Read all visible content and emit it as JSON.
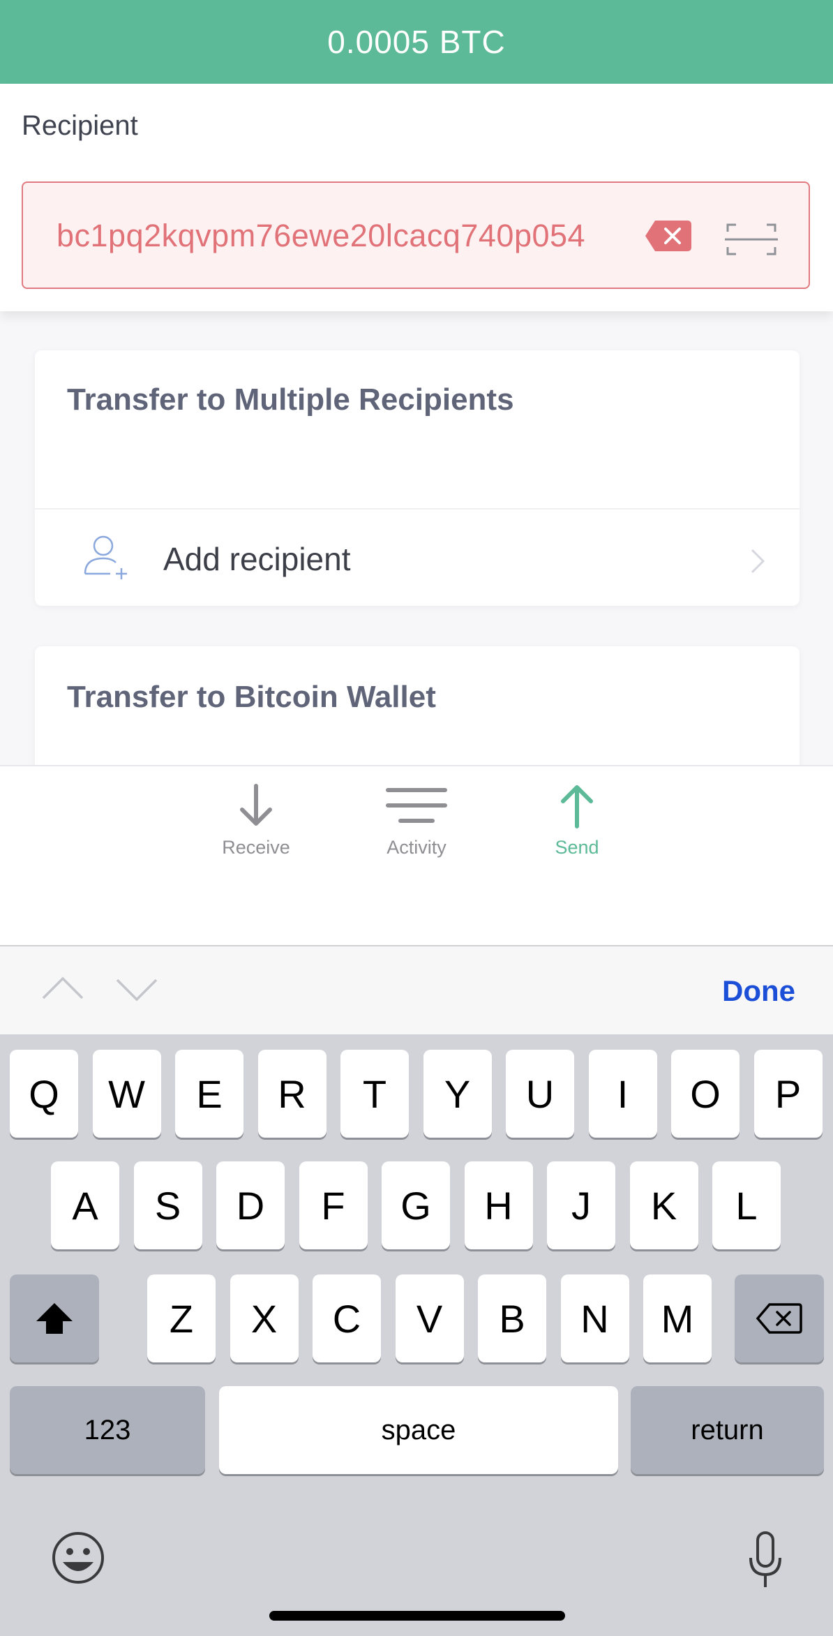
{
  "header": {
    "amount": "0.0005 BTC"
  },
  "recipient": {
    "label": "Recipient",
    "address": "bc1pq2kqvpm76ewe20lcacq740p054"
  },
  "cards": {
    "multiple": {
      "title": "Transfer to Multiple Recipients",
      "add_label": "Add recipient"
    },
    "wallet": {
      "title": "Transfer to Bitcoin Wallet"
    }
  },
  "tabs": [
    {
      "label": "Receive",
      "icon": "arrow-down-icon",
      "active": false
    },
    {
      "label": "Activity",
      "icon": "list-lines-icon",
      "active": false
    },
    {
      "label": "Send",
      "icon": "arrow-up-icon",
      "active": true
    }
  ],
  "toolbar": {
    "done_label": "Done"
  },
  "keyboard": {
    "row1": [
      "Q",
      "W",
      "E",
      "R",
      "T",
      "Y",
      "U",
      "I",
      "O",
      "P"
    ],
    "row2": [
      "A",
      "S",
      "D",
      "F",
      "G",
      "H",
      "J",
      "K",
      "L"
    ],
    "row3": [
      "Z",
      "X",
      "C",
      "V",
      "B",
      "N",
      "M"
    ],
    "numbers_label": "123",
    "space_label": "space",
    "return_label": "return"
  },
  "colors": {
    "brand": "#5cba98",
    "error": "#e07278",
    "link": "#1c4fd8"
  }
}
